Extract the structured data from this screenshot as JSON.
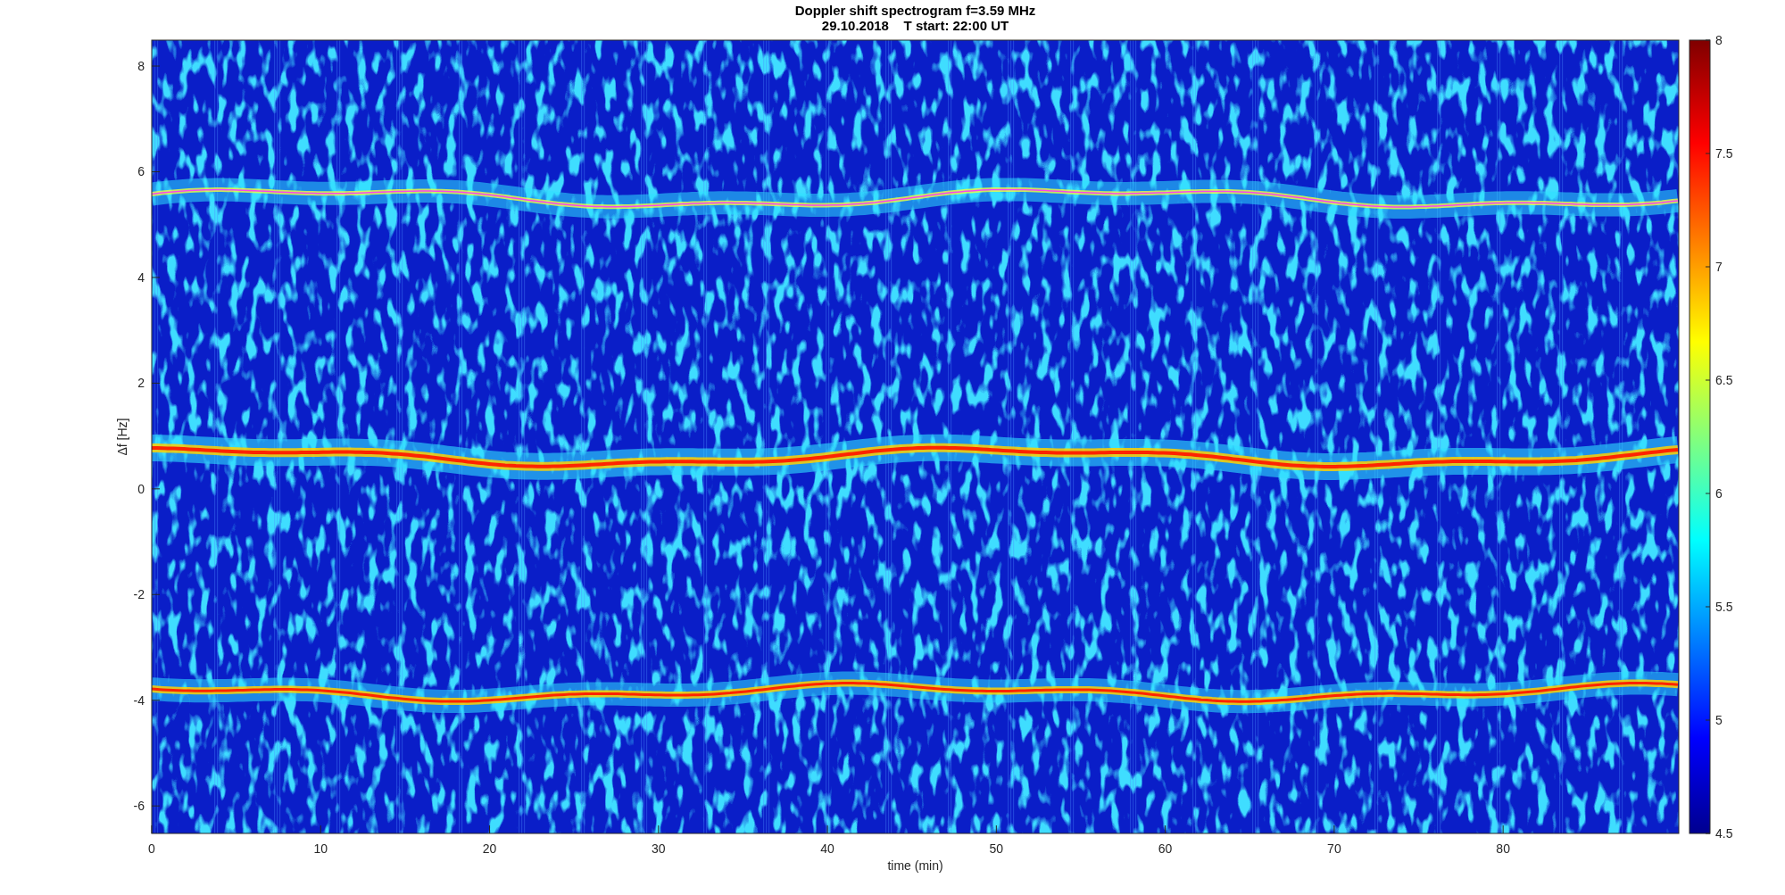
{
  "figure": {
    "title_lines": [
      "Doppler shift spectrogram f=3.59 MHz",
      "29.10.2018    T start: 22:00 UT"
    ],
    "xlabel": "time (min)",
    "ylabel": "Δf [Hz]",
    "xticks": [
      "0",
      "10",
      "20",
      "30",
      "40",
      "50",
      "60",
      "70",
      "80"
    ],
    "yticks": [
      "8",
      "6",
      "4",
      "2",
      "0",
      "-2",
      "-4",
      "-6"
    ],
    "colorbar_ticks": [
      "8",
      "7.5",
      "7",
      "6.5",
      "6",
      "5.5",
      "5",
      "4.5"
    ]
  }
}
